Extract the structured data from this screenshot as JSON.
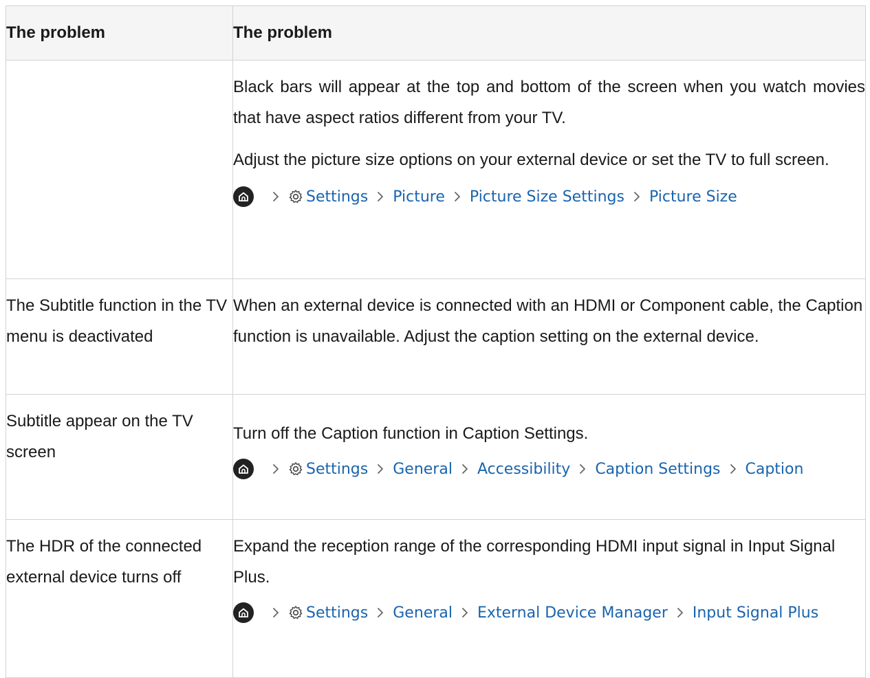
{
  "table": {
    "header": {
      "col1": "The problem",
      "col2": "The problem"
    },
    "rows": [
      {
        "problem": "",
        "paragraphs": [
          "Black bars will appear at the top and bottom of the screen when you watch movies that have aspect ratios different from your TV.",
          "Adjust the picture size options on your external device or set the TV to full screen."
        ],
        "path": [
          "Settings",
          "Picture",
          "Picture Size Settings",
          "Picture Size"
        ]
      },
      {
        "problem": "The Subtitle function in the TV menu is deactivated",
        "paragraphs": [
          "When an external device is connected with an HDMI or Component cable, the Caption function is unavailable. Adjust the caption setting on the external device."
        ]
      },
      {
        "problem": "Subtitle appear on the TV screen",
        "paragraphs": [
          "Turn off the Caption function in Caption Settings."
        ],
        "path": [
          "Settings",
          "General",
          "Accessibility",
          "Caption Settings",
          "Caption"
        ]
      },
      {
        "problem": "The HDR of the connected external device turns off",
        "paragraphs": [
          "Expand the reception range of the corresponding HDMI input signal in Input Signal Plus."
        ],
        "path": [
          "Settings",
          "General",
          "External Device Manager",
          "Input Signal Plus"
        ]
      }
    ]
  },
  "colors": {
    "link": "#1a64ad",
    "border": "#d2d2d2",
    "header_bg": "#f5f5f5"
  },
  "icons": {
    "home": "home-icon",
    "settings": "gear-icon",
    "separator": "chevron-right-icon"
  }
}
